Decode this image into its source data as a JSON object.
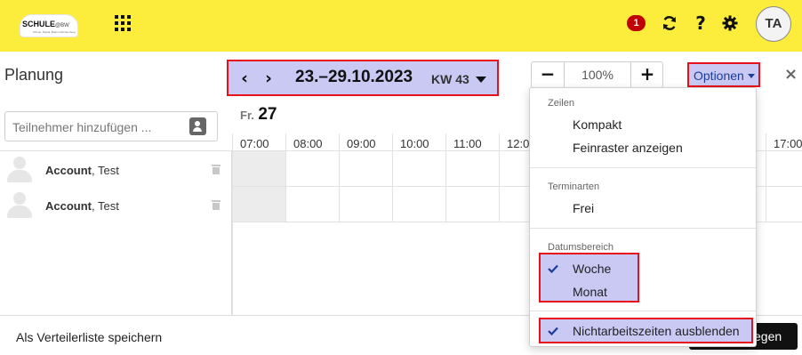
{
  "header": {
    "logo_text": "SCHULE",
    "logo_suffix": "@BW",
    "logo_subtitle": "Schule. Digital. Baden-Württemberg",
    "notification_count": "1",
    "help_label": "?",
    "avatar_initials": "TA",
    "background_color": "#fcec3c"
  },
  "page": {
    "title": "Planung"
  },
  "search": {
    "placeholder": "Teilnehmer hinzufügen ..."
  },
  "participants": [
    {
      "last_name": "Account",
      "first_name": ", Test"
    },
    {
      "last_name": "Account",
      "first_name": ", Test"
    }
  ],
  "footer": {
    "distribution_list_label": "Als Verteilerliste speichern",
    "save_button_label": "egen"
  },
  "date_nav": {
    "prev_label": "‹",
    "next_label": "›",
    "range": "23.–29.10.2023",
    "week": "KW 43"
  },
  "zoom": {
    "minus_label": "−",
    "value": "100%",
    "plus_label": "+"
  },
  "options": {
    "label": "Optionen",
    "close_label": "×"
  },
  "calendar": {
    "day_name": "Fr.",
    "day_number": "27",
    "hours": [
      "07:00",
      "08:00",
      "09:00",
      "10:00",
      "11:00",
      "12:0",
      "17:00"
    ]
  },
  "menu": {
    "section_rows": "Zeilen",
    "compact": "Kompakt",
    "fine_grid": "Feinraster anzeigen",
    "section_types": "Terminarten",
    "free": "Frei",
    "section_range": "Datumsbereich",
    "week": "Woche",
    "month": "Monat",
    "hide_nonwork": "Nichtarbeitszeiten ausblenden",
    "week_checked": true,
    "hide_nonwork_checked": true
  },
  "colors": {
    "highlight_fill": "#c9c9f4",
    "highlight_border": "#e8101a",
    "badge": "#c00000",
    "link_blue": "#1a3e9a"
  }
}
